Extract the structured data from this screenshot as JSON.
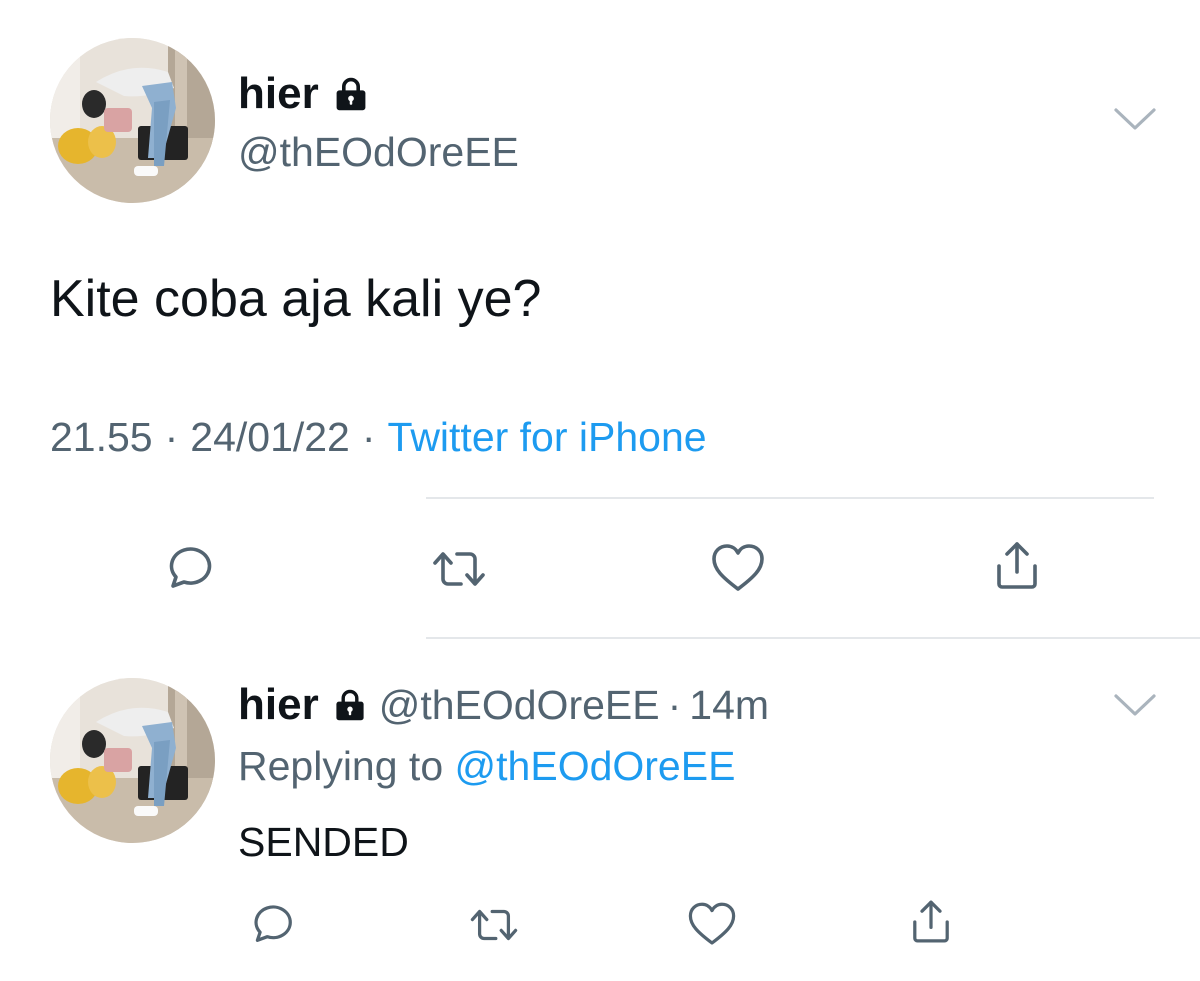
{
  "main_tweet": {
    "display_name": "hier",
    "handle": "@thEOdOreEE",
    "text": "Kite coba aja kali ye?",
    "time": "21.55",
    "date": "24/01/22",
    "source": "Twitter for iPhone",
    "meta_separator": "·",
    "icons": {
      "lock": "lock-icon",
      "more": "chevron-down-icon",
      "actions": [
        "reply-icon",
        "retweet-icon",
        "like-icon",
        "share-icon"
      ]
    }
  },
  "reply_tweet": {
    "display_name": "hier",
    "handle": "@thEOdOreEE",
    "separator": "·",
    "time_ago": "14m",
    "replying_prefix": "Replying to",
    "replying_to": "@thEOdOreEE",
    "text": "SENDED",
    "icons": {
      "lock": "lock-icon",
      "more": "chevron-down-icon",
      "actions": [
        "reply-icon",
        "retweet-icon",
        "like-icon",
        "share-icon"
      ]
    }
  },
  "colors": {
    "text_primary": "#0f1419",
    "text_secondary": "#536471",
    "link": "#1d9bf0",
    "icon": "#536471",
    "divider": "#e4e7ea",
    "background": "#ffffff"
  }
}
